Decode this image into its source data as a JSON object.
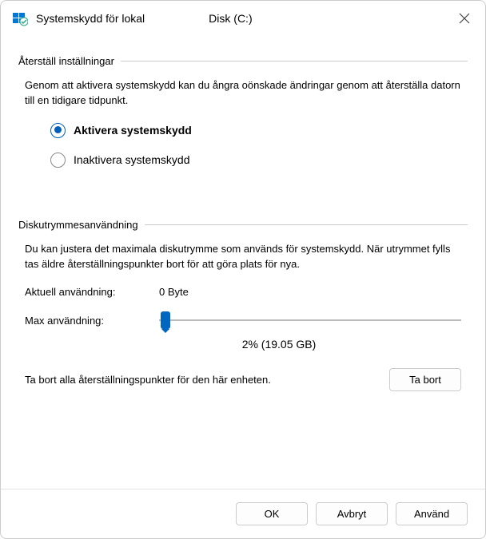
{
  "title": "Systemskydd för lokal",
  "disk": "Disk (C:)",
  "section_restore": {
    "header": "Återställ inställningar",
    "desc": "Genom att aktivera systemskydd kan du ångra oönskade ändringar genom att återställa datorn till en tidigare tidpunkt.",
    "option_enable": "Aktivera systemskydd",
    "option_disable": "Inaktivera systemskydd"
  },
  "section_usage": {
    "header": "Diskutrymmesanvändning",
    "desc": "Du kan justera det maximala diskutrymme som används för systemskydd. När utrymmet fylls tas äldre återställningspunkter bort för att göra plats för nya.",
    "current_label": "Aktuell användning:",
    "current_value": "0 Byte",
    "max_label": "Max användning:",
    "slider_value": "2% (19.05 GB)",
    "delete_text": "Ta bort alla återställningspunkter för den här enheten.",
    "delete_button": "Ta bort"
  },
  "buttons": {
    "ok": "OK",
    "cancel": "Avbryt",
    "apply": "Använd"
  }
}
